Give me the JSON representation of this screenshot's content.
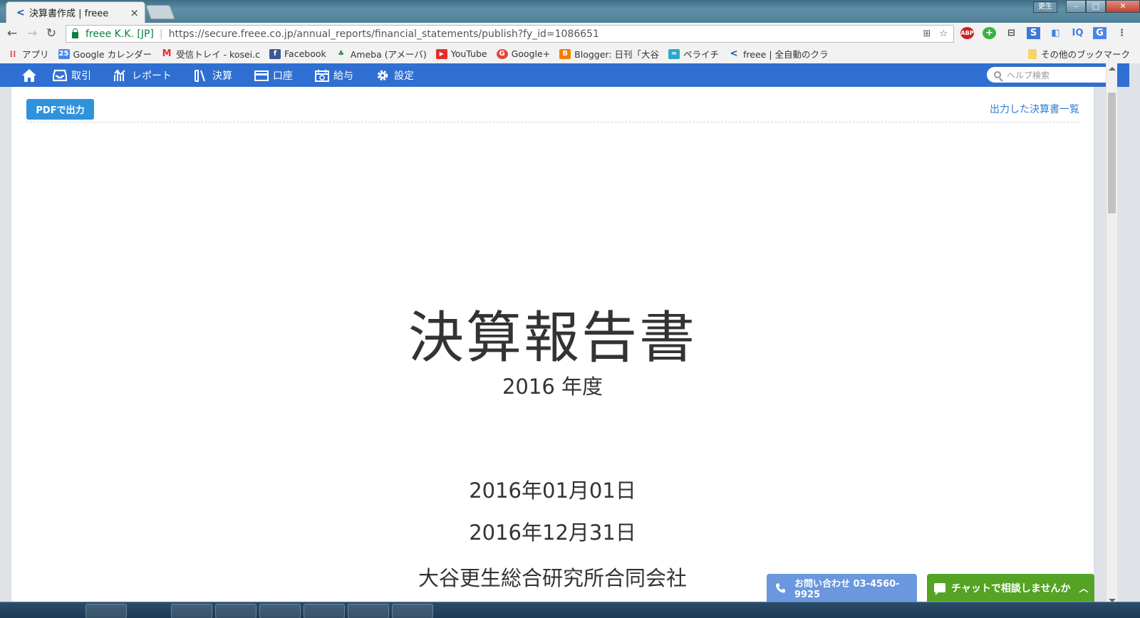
{
  "browser": {
    "tab_title": "決算書作成 | freee",
    "tab_close": "×",
    "user_badge": "更生",
    "omnibox": {
      "site_label": "freee K.K. [JP]",
      "url": "https://secure.freee.co.jp/annual_reports/financial_statements/publish?fy_id=1086651"
    },
    "bookmarks": [
      {
        "label": "アプリ",
        "icon": "apps-grid-icon"
      },
      {
        "label": "Google カレンダー",
        "icon": "google-calendar-icon",
        "badge": "25"
      },
      {
        "label": "受信トレイ - kosei.c",
        "icon": "gmail-icon",
        "badge": "M"
      },
      {
        "label": "Facebook",
        "icon": "facebook-icon",
        "badge": "f"
      },
      {
        "label": "Ameba (アメーバ)",
        "icon": "ameba-icon"
      },
      {
        "label": "YouTube",
        "icon": "youtube-icon"
      },
      {
        "label": "Google+",
        "icon": "google-plus-icon",
        "badge": "G"
      },
      {
        "label": "Blogger: 日刊「大谷",
        "icon": "blogger-icon",
        "badge": "B"
      },
      {
        "label": "ペライチ",
        "icon": "peraichi-icon"
      },
      {
        "label": "freee | 全自動のクラ",
        "icon": "freee-icon"
      }
    ],
    "other_bookmarks": "その他のブックマーク",
    "extensions": [
      "ABP",
      "+",
      "⊟",
      "S",
      "◧",
      "IQ",
      "G"
    ]
  },
  "app_nav": {
    "items": [
      {
        "label": "取引",
        "icon": "inbox-icon"
      },
      {
        "label": "レポート",
        "icon": "chart-icon"
      },
      {
        "label": "決算",
        "icon": "books-icon"
      },
      {
        "label": "口座",
        "icon": "card-icon"
      },
      {
        "label": "給与",
        "icon": "calendar-icon"
      },
      {
        "label": "設定",
        "icon": "gear-icon"
      }
    ],
    "help_search_placeholder": "ヘルプ検索"
  },
  "page": {
    "pdf_button": "PDFで出力",
    "list_link": "出力した決算書一覧",
    "document": {
      "title": "決算報告書",
      "fiscal_year": "2016 年度",
      "period_start": "2016年01月01日",
      "period_end": "2016年12月31日",
      "company": "大谷更生総合研究所合同会社"
    }
  },
  "widgets": {
    "contact": "お問い合わせ 03-4560-9925",
    "chat": "チャットで相談しませんか"
  },
  "colors": {
    "nav_bg": "#2f6fd1",
    "pdf_button": "#2f93dc",
    "link": "#2f7fd0",
    "chat": "#54a324",
    "contact": "#6a97dd",
    "secure_green": "#0b8043"
  }
}
